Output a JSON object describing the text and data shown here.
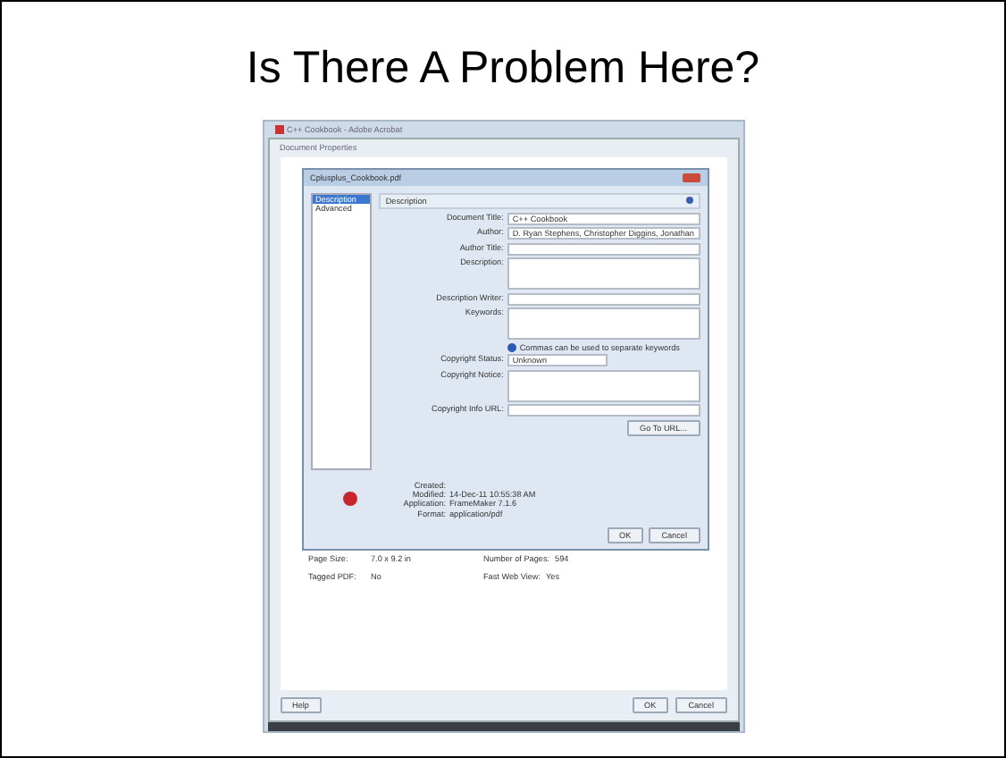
{
  "slide_title": "Is There A Problem Here?",
  "app_window": {
    "title": "C++ Cookbook - Adobe Acrobat"
  },
  "properties_dialog": {
    "title": "Document Properties",
    "background_rows": [
      {
        "label_1": "Page Size:",
        "value_1": "7.0 x 9.2 in",
        "label_2": "Number of Pages:",
        "value_2": "594"
      },
      {
        "label_1": "Tagged PDF:",
        "value_1": "No",
        "label_2": "Fast Web View:",
        "value_2": "Yes"
      }
    ],
    "buttons": [
      "Help",
      "OK",
      "Cancel"
    ]
  },
  "metadata_dialog": {
    "title": "Cplusplus_Cookbook.pdf",
    "sidebar": [
      {
        "label": "Description",
        "selected": true
      },
      {
        "label": "Advanced",
        "selected": false
      }
    ],
    "section_header": "Description",
    "fields": [
      {
        "kind": "text",
        "label": "Document Title:",
        "value": "C++ Cookbook"
      },
      {
        "kind": "text",
        "label": "Author:",
        "value": "D. Ryan Stephens, Christopher Diggins, Jonathan"
      },
      {
        "kind": "text",
        "label": "Author Title:"
      },
      {
        "kind": "textarea",
        "label": "Description:"
      },
      {
        "kind": "text",
        "label": "Description Writer:"
      },
      {
        "kind": "textarea",
        "label": "Keywords:"
      },
      {
        "kind": "hint",
        "label": "Commas can be used to separate keywords"
      },
      {
        "kind": "select",
        "label": "Copyright Status:",
        "value": "Unknown"
      },
      {
        "kind": "textarea",
        "label": "Copyright Notice:"
      },
      {
        "kind": "text",
        "label": "Copyright Info URL:"
      }
    ],
    "url_button": "Go To URL...",
    "info": [
      {
        "label": "Created:"
      },
      {
        "label": "Modified:",
        "value": "14-Dec-11 10:55:38 AM"
      },
      {
        "label": "Application:",
        "value": "FrameMaker 7.1.6"
      },
      {
        "label": "Format:",
        "value": "application/pdf"
      }
    ],
    "buttons": [
      "OK",
      "Cancel"
    ]
  }
}
